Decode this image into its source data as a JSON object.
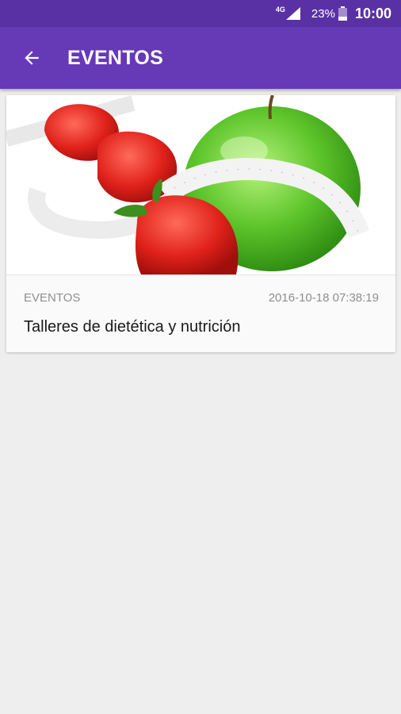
{
  "status_bar": {
    "network": "4G",
    "battery_percent": "23%",
    "time": "10:00"
  },
  "app_bar": {
    "title": "EVENTOS",
    "back_icon": "arrow-left-icon"
  },
  "colors": {
    "status_bar": "#5a31a4",
    "app_bar": "#6639b7",
    "background": "#eeeeee"
  },
  "events": [
    {
      "image_subject": "green apple, strawberries and measuring tape",
      "category": "EVENTOS",
      "datetime": "2016-10-18 07:38:19",
      "title": "Talleres de dietética y nutrición"
    }
  ]
}
